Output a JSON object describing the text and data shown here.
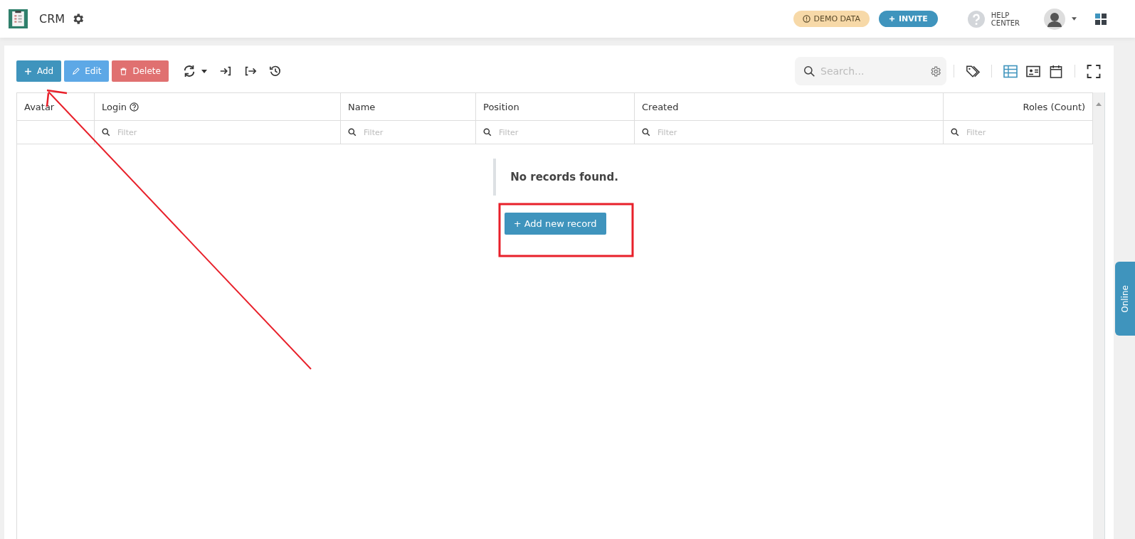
{
  "header": {
    "app_name": "CRM",
    "demo_badge": "DEMO DATA",
    "invite_button": "INVITE",
    "help": [
      "HELP",
      "CENTER"
    ]
  },
  "toolbar": {
    "buttons": [
      {
        "label": "Add",
        "kind": "add"
      },
      {
        "label": "Edit",
        "kind": "edit"
      },
      {
        "label": "Delete",
        "kind": "delete"
      }
    ],
    "search": {
      "placeholder": "Search..."
    }
  },
  "table": {
    "columns": [
      {
        "label": "Avatar",
        "help": false
      },
      {
        "label": "Login",
        "help": true,
        "placeholder": "Filter"
      },
      {
        "label": "Name",
        "help": false,
        "placeholder": "Filter"
      },
      {
        "label": "Position",
        "help": false,
        "placeholder": "Filter"
      },
      {
        "label": "Created",
        "help": false,
        "placeholder": "Filter"
      },
      {
        "label": "Roles (Count)",
        "help": false,
        "placeholder": "Filter"
      }
    ],
    "empty_message": "No records found.",
    "add_record_button": "+ Add new record"
  },
  "online_tab": "Online"
}
